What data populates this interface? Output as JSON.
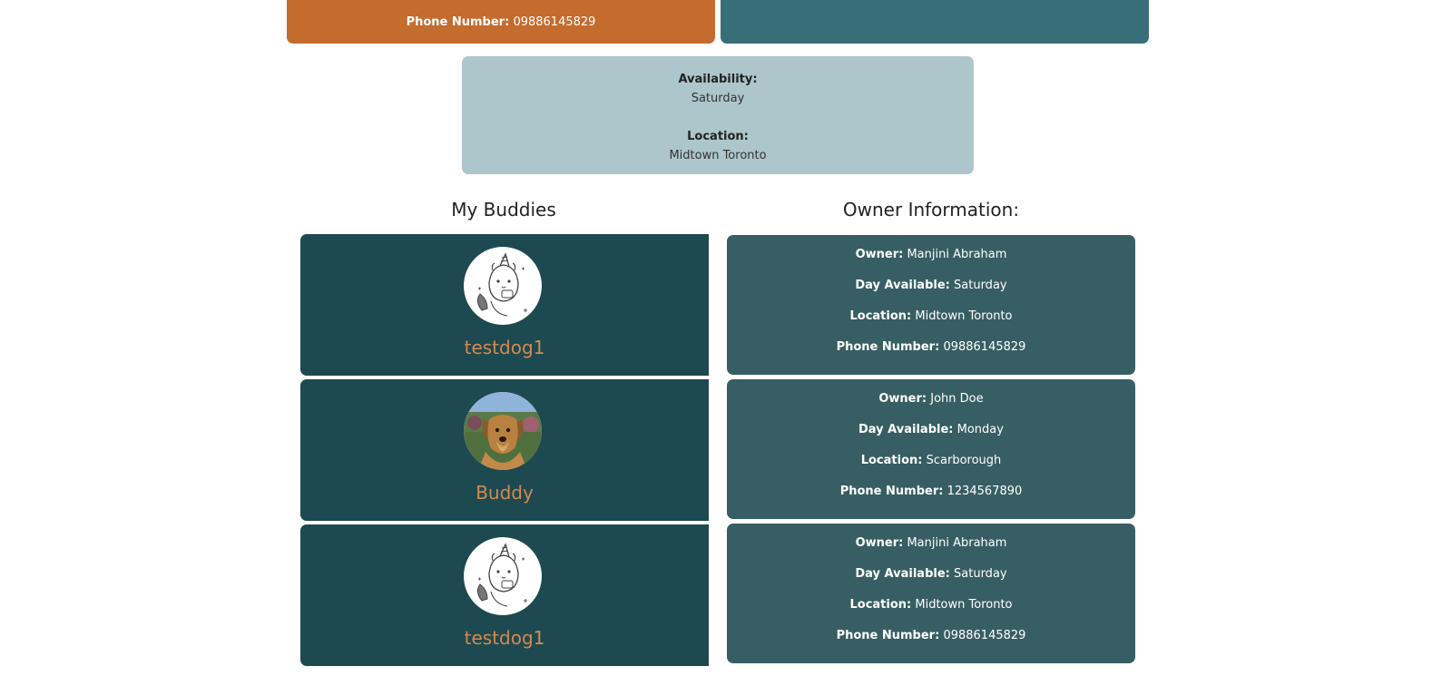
{
  "top_card": {
    "phone_label": "Phone Number:",
    "phone_value": "09886145829"
  },
  "availability_card": {
    "availability_label": "Availability:",
    "availability_value": "Saturday",
    "location_label": "Location:",
    "location_value": "Midtown Toronto"
  },
  "headings": {
    "buddies": "My Buddies",
    "owner": "Owner Information:"
  },
  "labels": {
    "owner": "Owner:",
    "day": "Day Available:",
    "location": "Location:",
    "phone": "Phone Number:"
  },
  "buddies": [
    {
      "name": "testdog1",
      "avatar": "unicorn-cat-sketch",
      "owner": "Manjini Abraham",
      "day": "Saturday",
      "location": "Midtown Toronto",
      "phone": "09886145829"
    },
    {
      "name": "Buddy",
      "avatar": "golden-dog-photo",
      "owner": "John Doe",
      "day": "Monday",
      "location": "Scarborough",
      "phone": "1234567890"
    },
    {
      "name": "testdog1",
      "avatar": "unicorn-cat-sketch",
      "owner": "Manjini Abraham",
      "day": "Saturday",
      "location": "Midtown Toronto",
      "phone": "09886145829"
    }
  ],
  "colors": {
    "accent_orange": "#c46b2e",
    "teal": "#386e78",
    "light_teal": "#adc6cb",
    "buddy_card": "#1d4950",
    "owner_card": "#375e63",
    "name_color": "#d48a4f"
  }
}
